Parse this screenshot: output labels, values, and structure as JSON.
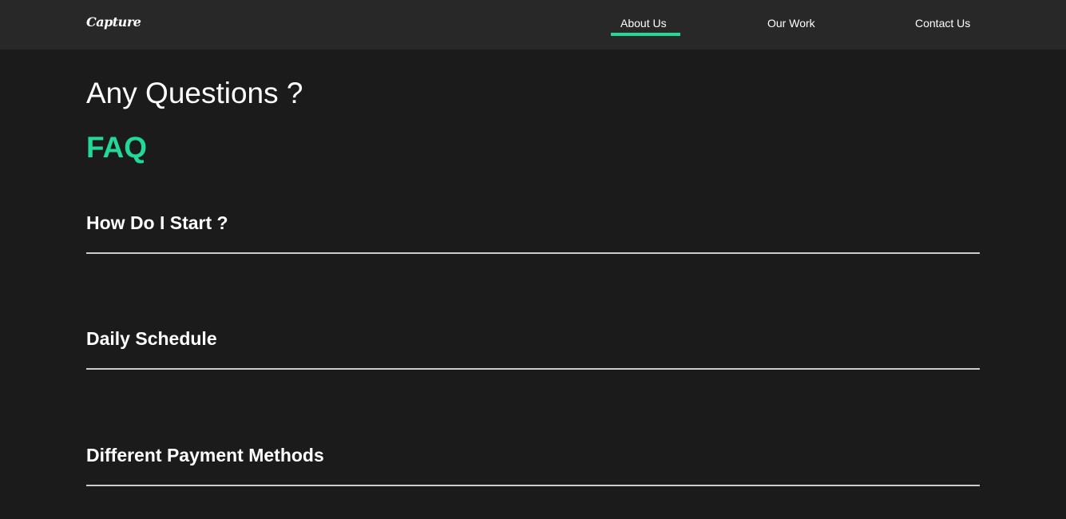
{
  "header": {
    "logo": "Capture",
    "nav": [
      {
        "label": "About Us",
        "active": true
      },
      {
        "label": "Our Work",
        "active": false
      },
      {
        "label": "Contact Us",
        "active": false
      }
    ]
  },
  "main": {
    "heading": "Any Questions ?",
    "faq_title": "FAQ",
    "faq_items": [
      {
        "question": "How Do I Start ?"
      },
      {
        "question": "Daily Schedule"
      },
      {
        "question": "Different Payment Methods"
      }
    ]
  },
  "colors": {
    "accent": "#23d997",
    "background": "#1b1b1b",
    "header_background": "#282828",
    "divider": "#cccccc"
  }
}
